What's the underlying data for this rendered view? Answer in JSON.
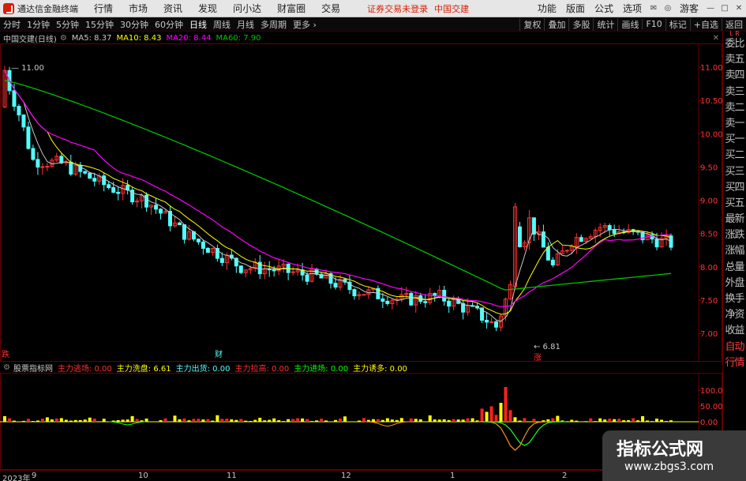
{
  "titlebar": {
    "app_name": "通达信金融终端",
    "menu": [
      "行情",
      "市场",
      "资讯",
      "发现",
      "问小达",
      "财富圈",
      "交易"
    ],
    "notice": "证券交易未登录",
    "stock_name": "中国交建",
    "right_menu": [
      "功能",
      "版面",
      "公式",
      "选项"
    ],
    "guest": "游客"
  },
  "toolbar": {
    "left": [
      "分时",
      "1分钟",
      "5分钟",
      "15分钟",
      "30分钟",
      "60分钟",
      "日线",
      "周线",
      "月线",
      "多周期",
      "更多 ›"
    ],
    "active": "日线",
    "right": [
      "复权",
      "叠加",
      "多股",
      "统计",
      "画线",
      "F10",
      "标记",
      "+自选",
      "返回"
    ]
  },
  "main_info": {
    "title": "中国交建(日线)",
    "ma5": "MA5: 8.37",
    "ma10": "MA10: 8.43",
    "ma20": "MA20: 8.44",
    "ma60": "MA60: 7.90"
  },
  "price_axis": [
    "11.00",
    "10.50",
    "10.00",
    "9.50",
    "9.00",
    "8.50",
    "8.00",
    "7.50",
    "7.00"
  ],
  "annotations": {
    "high": "11.00",
    "low": "6.81",
    "zhang": "涨",
    "die": "跌",
    "cai": "财"
  },
  "sub_info": {
    "title": "股票指标网",
    "items": [
      "主力逃场: 0.00",
      "主力洗盘: 6.61",
      "主力出货: 0.00",
      "主力拉高: 0.00",
      "主力进场: 0.00",
      "主力诱多: 0.00"
    ]
  },
  "sub_axis": [
    "100.0",
    "50.00",
    "0.00"
  ],
  "x_axis": [
    "2023年",
    "9",
    "10",
    "11",
    "12",
    "1",
    "2"
  ],
  "sidebar": [
    "委比",
    "卖五",
    "卖四",
    "卖三",
    "卖二",
    "卖一",
    "买一",
    "买二",
    "买三",
    "买四",
    "买五",
    "最新",
    "涨跌",
    "涨幅",
    "总量",
    "外盘",
    "换手",
    "净资",
    "收益",
    "自动",
    "行情"
  ],
  "sidebar_corner": "L R",
  "watermark": {
    "title": "指标公式网",
    "url": "www.zbgs3.com"
  },
  "colors": {
    "up": "#ff3232",
    "down": "#54fcfc",
    "ma5": "#c8c8c8",
    "ma10": "#ffff00",
    "ma20": "#ff00ff",
    "ma60": "#00c000"
  },
  "chart_data": {
    "type": "candlestick",
    "title": "中国交建(日线)",
    "ylim": [
      6.75,
      11.25
    ],
    "ma": {
      "MA5": 8.37,
      "MA10": 8.43,
      "MA20": 8.44,
      "MA60": 7.9
    },
    "high": 11.0,
    "low": 6.81,
    "subchart": {
      "type": "bar",
      "ylim": [
        -100,
        120
      ],
      "ticks": [
        100,
        50,
        0
      ],
      "values_label": {
        "主力逃场": 0,
        "主力洗盘": 6.61,
        "主力出货": 0,
        "主力拉高": 0,
        "主力进场": 0,
        "主力诱多": 0
      }
    }
  }
}
